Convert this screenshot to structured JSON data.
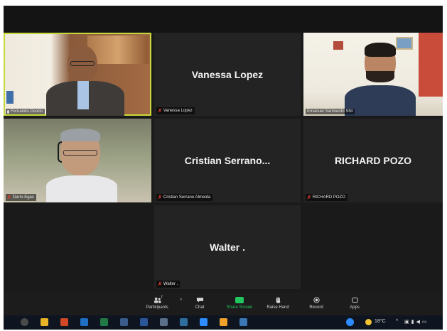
{
  "participants": [
    {
      "tile_name": "",
      "label": "Fernando Osorio",
      "muted": false
    },
    {
      "tile_name": "Vanessa Lopez",
      "label": "Vanessa Lopez",
      "muted": true
    },
    {
      "tile_name": "",
      "label": "Emanuel Sarmiento SNI",
      "muted": false
    },
    {
      "tile_name": "",
      "label": "Darío Egas",
      "muted": true
    },
    {
      "tile_name": "Cristian  Serrano...",
      "label": "Cristian Serrano Almeida",
      "muted": true
    },
    {
      "tile_name": "RICHARD POZO",
      "label": "RICHARD POZO",
      "muted": true
    },
    {
      "tile_name": "Walter .",
      "label": "Walter .",
      "muted": true
    }
  ],
  "toolbar": {
    "participants_label": "Participants",
    "participants_count": "7",
    "chat_label": "Chat",
    "share_label": "Share Screen",
    "raise_hand_label": "Raise Hand",
    "record_label": "Record",
    "apps_label": "Apps"
  },
  "taskbar": {
    "temperature": "18°C"
  },
  "colors": {
    "active_speaker": "#c6d93b",
    "share_green": "#22c55e",
    "muted_red": "#e03b2f"
  }
}
